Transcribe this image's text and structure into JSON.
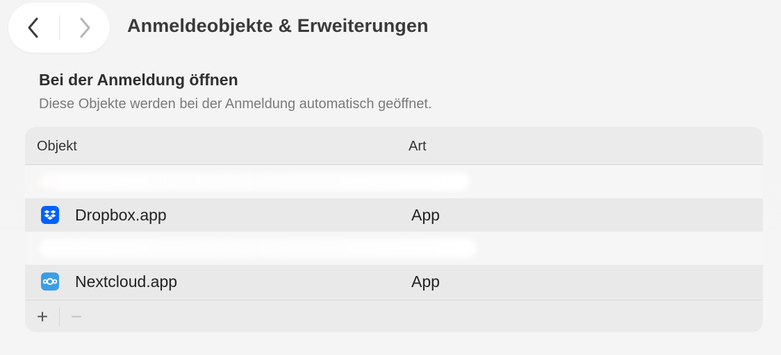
{
  "toolbar": {
    "title": "Anmeldeobjekte & Erweiterungen",
    "back_icon": "chevron-left-icon",
    "forward_icon": "chevron-right-icon"
  },
  "section": {
    "title": "Bei der Anmeldung öffnen",
    "subtitle": "Diese Objekte werden bei der Anmeldung automatisch geöffnet."
  },
  "table": {
    "columns": [
      "Objekt",
      "Art"
    ],
    "rows": [
      {
        "name": "",
        "type": "",
        "icon": "blurred-app-icon",
        "redacted": true
      },
      {
        "name": "Dropbox.app",
        "type": "App",
        "icon": "dropbox-icon",
        "redacted": false
      },
      {
        "name": "",
        "type": "",
        "icon": "blurred-app-icon",
        "redacted": true
      },
      {
        "name": "Nextcloud.app",
        "type": "App",
        "icon": "nextcloud-icon",
        "redacted": false
      }
    ]
  },
  "footer": {
    "add_label": "+",
    "remove_label": "−"
  },
  "colors": {
    "dropbox": "#0061fe",
    "nextcloud": "#3a9ee6"
  }
}
